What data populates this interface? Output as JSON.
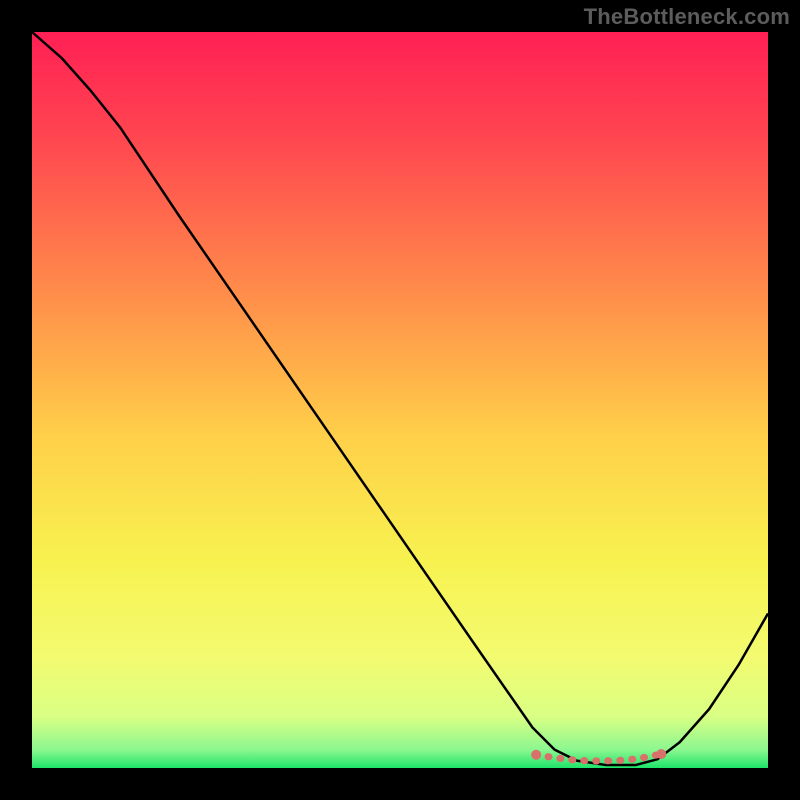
{
  "watermark": "TheBottleneck.com",
  "chart_data": {
    "type": "line",
    "title": "",
    "xlabel": "",
    "ylabel": "",
    "xlim": [
      0,
      100
    ],
    "ylim": [
      0,
      100
    ],
    "grid": false,
    "legend": false,
    "annotations": [],
    "series": [
      {
        "name": "curve",
        "color": "#000000",
        "x": [
          0,
          4,
          8,
          12,
          20,
          30,
          40,
          50,
          60,
          68,
          71,
          74,
          78,
          82,
          85,
          88,
          92,
          96,
          100
        ],
        "y": [
          100,
          96.5,
          92,
          87,
          75,
          60.5,
          46,
          31.5,
          17,
          5.5,
          2.5,
          1,
          0.4,
          0.4,
          1.2,
          3.5,
          8,
          14,
          21
        ]
      },
      {
        "name": "highlight-flat",
        "color": "#d9716b",
        "style": "dashed",
        "x": [
          68.5,
          71,
          73,
          75,
          77,
          79,
          81,
          83,
          85.5
        ],
        "y": [
          1.8,
          1.4,
          1.15,
          1.0,
          0.95,
          1.0,
          1.1,
          1.4,
          1.9
        ]
      }
    ],
    "background_gradient": {
      "type": "vertical",
      "stops": [
        {
          "pos": 0.0,
          "color": "#ff1f54"
        },
        {
          "pos": 0.15,
          "color": "#ff4850"
        },
        {
          "pos": 0.35,
          "color": "#ff8b4a"
        },
        {
          "pos": 0.55,
          "color": "#ffd049"
        },
        {
          "pos": 0.72,
          "color": "#f7f250"
        },
        {
          "pos": 0.85,
          "color": "#f3fb70"
        },
        {
          "pos": 0.93,
          "color": "#d9ff84"
        },
        {
          "pos": 0.975,
          "color": "#8cf78f"
        },
        {
          "pos": 1.0,
          "color": "#1ee46a"
        }
      ]
    }
  }
}
